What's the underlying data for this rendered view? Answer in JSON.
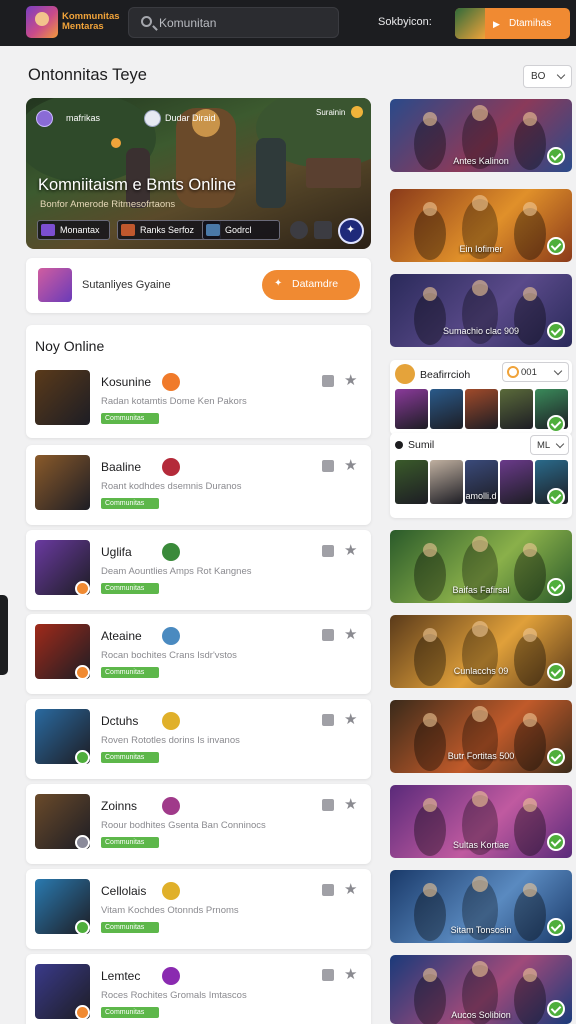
{
  "app": {
    "title": "Kommunitas Mentaras"
  },
  "search": {
    "value": "",
    "placeholder": "Komunitan"
  },
  "header": {
    "label": "Sokbyicon:",
    "cta_label": "Dtamihas",
    "cta_play": "▶"
  },
  "page": {
    "title": "Ontonnitas Teye",
    "filter_value": "BO"
  },
  "hero": {
    "user_name": "mafrikas",
    "server_name": "Dudar Diraid",
    "right_label": "Surainin",
    "title": "Komniitaism e Bmts Online",
    "subtitle": "Bonfor Amerode Ritmesofrtaons",
    "buttons": [
      "Monantax",
      "Ranks Serfoz",
      "Godrcl"
    ]
  },
  "subscription": {
    "label": "Sutanliyes Gyaine",
    "button_label": "Datamdre",
    "button_icon": "✦"
  },
  "online": {
    "title": "Noy Online",
    "items": [
      {
        "name": "Kosunine",
        "desc": "Radan kotamtis Dome Ken Pakors",
        "badge": "Communitas",
        "avatar": "#5a3a1a",
        "game": "#f07a2a",
        "status": ""
      },
      {
        "name": "Baaline",
        "desc": "Roant kodhdes dsemnis Duranos",
        "badge": "Communitas",
        "avatar": "#8a5a2a",
        "game": "#b42a3a",
        "status": ""
      },
      {
        "name": "Uglifa",
        "desc": "Deam Aountlies Amps Rot Kangnes",
        "badge": "Communitas",
        "avatar": "#6a3aa0",
        "game": "#3a8a3a",
        "status": "#f08a32"
      },
      {
        "name": "Ateaine",
        "desc": "Rocan bochites Crans Isdr'vstos",
        "badge": "Communitas",
        "avatar": "#a02a1a",
        "game": "#4a8ac0",
        "status": "#f08a32"
      },
      {
        "name": "Dctuhs",
        "desc": "Roven Rototles dorins Is invanos",
        "badge": "Communitas",
        "avatar": "#2a6aa0",
        "game": "#e0b02a",
        "status": "#4fae3c"
      },
      {
        "name": "Zoinns",
        "desc": "Roour bodhites Gsenta Ban Conninocs",
        "badge": "Communitas",
        "avatar": "#6a4a2a",
        "game": "#a03a8a",
        "status": "#8a8a9a"
      },
      {
        "name": "Cellolais",
        "desc": "Vitam Kochdes Otonnds Prnoms",
        "badge": "Communitas",
        "avatar": "#2a7ab0",
        "game": "#e0b02a",
        "status": "#4fae3c"
      },
      {
        "name": "Lemtec",
        "desc": "Roces Rochites Gromals Imtascos",
        "badge": "Communitas",
        "avatar": "#3a3a8a",
        "game": "#8a2ab0",
        "status": "#f08a32"
      }
    ]
  },
  "side_cards": [
    {
      "label": "Antes Kalinon",
      "bg": "#2a4a8a",
      "bg2": "#8a3a5a"
    },
    {
      "label": "Ein Iofimer",
      "bg": "#8a3a1a",
      "bg2": "#e0902a"
    },
    {
      "label": "Sumachio clac 909",
      "bg": "#2a2a5a",
      "bg2": "#5a4a8a"
    },
    {
      "label": "Baifas Fafirsal",
      "bg": "#2a5a2a",
      "bg2": "#8ab04a"
    },
    {
      "label": "Cunlacchs 09",
      "bg": "#5a3a1a",
      "bg2": "#e0a03a"
    },
    {
      "label": "Butr Fortitas 500",
      "bg": "#3a2a1a",
      "bg2": "#c05a2a"
    },
    {
      "label": "Sultas Kortiae",
      "bg": "#5a2a7a",
      "bg2": "#c05aa0"
    },
    {
      "label": "Sitam Tonsosin",
      "bg": "#1a3a6a",
      "bg2": "#5a8ac0"
    },
    {
      "label": "Aucos Solibion",
      "bg": "#1a3a7a",
      "bg2": "#a04a7a"
    }
  ],
  "panel_1": {
    "title": "Beafirrcioh",
    "select_value": "001",
    "tiles": [
      "#8a3a9a",
      "#2a5a8a",
      "#a04a2a",
      "#5a6a3a",
      "#3a8a5a"
    ]
  },
  "panel_2": {
    "title": "Sumil",
    "select_value": "ML",
    "center_label": "amolli.d",
    "tiles": [
      "#3a5a2a",
      "#c0b0a0",
      "#3a4a7a",
      "#6a3a8a",
      "#2a6a8a"
    ]
  }
}
